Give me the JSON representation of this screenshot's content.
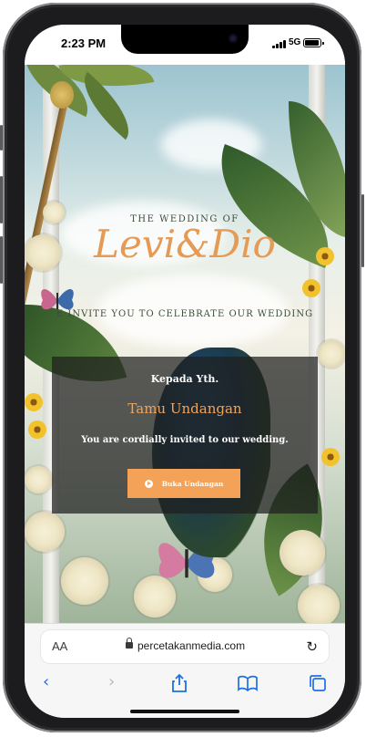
{
  "status_bar": {
    "time": "2:23 PM",
    "network": "5G"
  },
  "invitation": {
    "heading": "THE WEDDING OF",
    "couple": "Levi&Dio",
    "tagline": "E INVITE YOU TO CELEBRATE OUR WEDDING",
    "recipient_prefix": "Kepada Yth.",
    "guest_name": "Tamu Undangan",
    "invite_message": "You are cordially invited to our wedding.",
    "open_button": "Buka Undangan",
    "accent_color": "#f4a257"
  },
  "browser": {
    "text_size_label": "AA",
    "url": "percetakanmedia.com",
    "reload_icon": "reload-icon",
    "toolbar_icons": [
      "back-icon",
      "forward-icon",
      "share-icon",
      "bookmarks-icon",
      "tabs-icon"
    ]
  }
}
